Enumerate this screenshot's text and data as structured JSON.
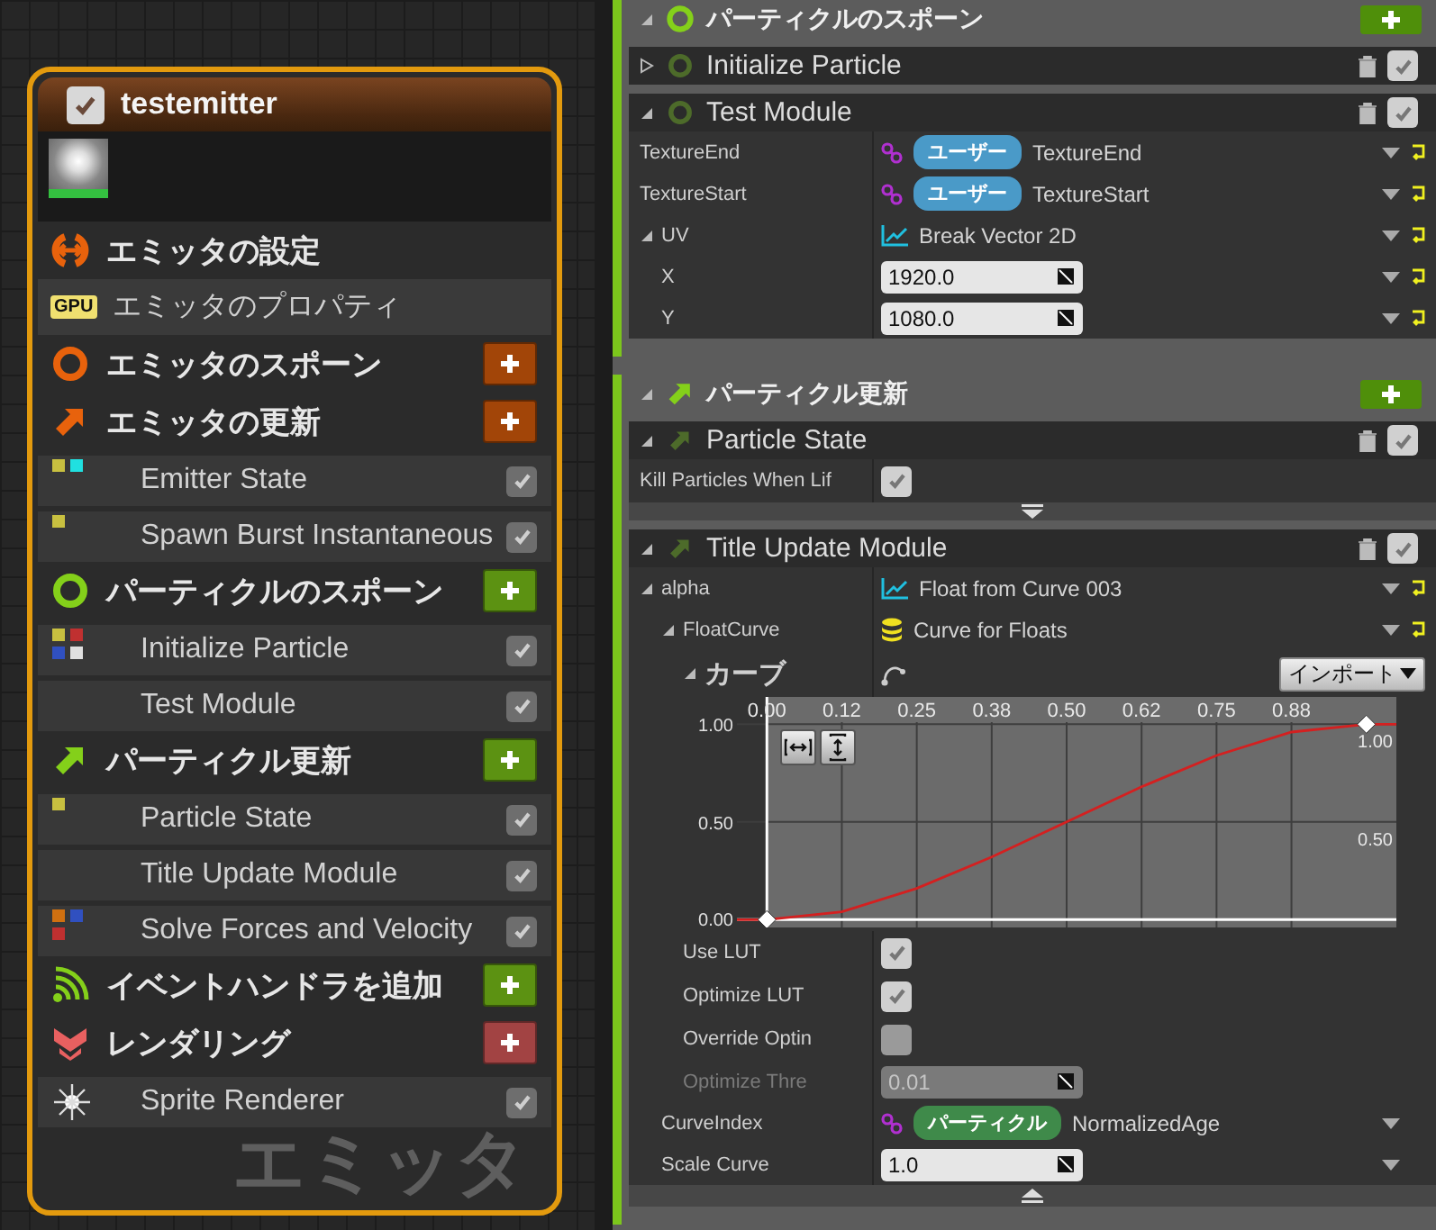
{
  "emitter_node": {
    "title": "testemitter",
    "enabled": true,
    "watermark": "エミッタ",
    "items": [
      {
        "kind": "settings",
        "label": "エミッタの設定",
        "color": "#e8620c"
      },
      {
        "kind": "properties",
        "badge": "GPU",
        "label": "エミッタのプロパティ"
      },
      {
        "kind": "spawn",
        "label": "エミッタのスポーン",
        "color": "#e8620c"
      },
      {
        "kind": "update",
        "label": "エミッタの更新",
        "color": "#e8620c"
      },
      {
        "kind": "module",
        "label": "Emitter State",
        "checked": true,
        "dots": [
          {
            "color": "#c8c040"
          },
          {
            "color": "#20e0e0"
          }
        ]
      },
      {
        "kind": "module",
        "label": "Spawn Burst Instantaneous",
        "checked": true,
        "dots": [
          {
            "color": "#c8c040"
          }
        ]
      },
      {
        "kind": "spawn",
        "label": "パーティクルのスポーン",
        "color": "#84d01a"
      },
      {
        "kind": "module",
        "label": "Initialize Particle",
        "checked": true,
        "dots": [
          {
            "color": "#c8c040"
          },
          {
            "color": "#c03030"
          },
          {
            "color": "#3050c0"
          },
          {
            "color": "#e0e0e0"
          }
        ]
      },
      {
        "kind": "module",
        "label": "Test Module",
        "checked": true
      },
      {
        "kind": "update",
        "label": "パーティクル更新",
        "color": "#84d01a"
      },
      {
        "kind": "module",
        "label": "Particle State",
        "checked": true,
        "dots": [
          {
            "color": "#c8c040"
          }
        ]
      },
      {
        "kind": "module",
        "label": "Title Update Module",
        "checked": true
      },
      {
        "kind": "module",
        "label": "Solve Forces and Velocity",
        "checked": true,
        "dots": [
          {
            "color": "#d07010"
          },
          {
            "color": "#3050c0"
          },
          {
            "color": "#c03030"
          }
        ]
      },
      {
        "kind": "event",
        "label": "イベントハンドラを追加",
        "color": "#84d01a"
      },
      {
        "kind": "render",
        "label": "レンダリング",
        "color": "#e86060"
      },
      {
        "kind": "renderer",
        "label": "Sprite Renderer",
        "checked": true
      }
    ]
  },
  "stack": {
    "sections": [
      {
        "kind": "spawn",
        "title": "パーティクルのスポーン",
        "expanded": true,
        "modules": [
          {
            "title": "Initialize Particle",
            "expanded": false,
            "enabled": true
          },
          {
            "title": "Test Module",
            "expanded": true,
            "enabled": true,
            "rows": [
              {
                "kind": "link",
                "label": "TextureEnd",
                "tag": "ユーザー",
                "color": "#4a9ac8",
                "value": "TextureEnd",
                "reset": true
              },
              {
                "kind": "link",
                "label": "TextureStart",
                "tag": "ユーザー",
                "color": "#4a9ac8",
                "value": "TextureStart",
                "reset": true
              },
              {
                "kind": "function",
                "label": "UV",
                "value": "Break Vector 2D",
                "reset": true,
                "expanded": true,
                "children": [
                  {
                    "kind": "number",
                    "label": "X",
                    "value": "1920.0",
                    "reset": true
                  },
                  {
                    "kind": "number",
                    "label": "Y",
                    "value": "1080.0",
                    "reset": true
                  }
                ]
              }
            ]
          }
        ]
      },
      {
        "kind": "update",
        "title": "パーティクル更新",
        "expanded": true,
        "modules": [
          {
            "title": "Particle State",
            "expanded": true,
            "enabled": true,
            "advanced_shown": false,
            "rows": [
              {
                "kind": "check",
                "label": "Kill Particles When Lif",
                "checked": true
              }
            ]
          },
          {
            "title": "Title Update Module",
            "expanded": true,
            "enabled": true,
            "advanced_shown": true,
            "rows": [
              {
                "kind": "function",
                "label": "alpha",
                "value": "Float from Curve 003",
                "reset": true,
                "expanded": true,
                "children": [
                  {
                    "kind": "asset",
                    "label": "FloatCurve",
                    "value": "Curve for Floats",
                    "reset": true,
                    "expanded": true,
                    "children": [
                      {
                        "kind": "curve",
                        "label": "カーブ",
                        "expanded": true,
                        "button": "インポート",
                        "chart_data": {
                          "type": "line",
                          "xlim": [
                            -0.05,
                            1.05
                          ],
                          "ylim": [
                            -0.04,
                            1.14
                          ],
                          "grid": true,
                          "x": [
                            -0.05,
                            0,
                            0.125,
                            0.25,
                            0.375,
                            0.5,
                            0.625,
                            0.75,
                            0.875,
                            1,
                            1.05
                          ],
                          "series": [
                            {
                              "color": "#d42020",
                              "values": [
                                0,
                                0,
                                0.04,
                                0.16,
                                0.32,
                                0.5,
                                0.68,
                                0.84,
                                0.96,
                                1,
                                1
                              ]
                            }
                          ],
                          "xticks": [
                            {
                              "value": 0,
                              "label": "0.00"
                            },
                            {
                              "value": 0.125,
                              "label": "0.12"
                            },
                            {
                              "value": 0.25,
                              "label": "0.25"
                            },
                            {
                              "value": 0.375,
                              "label": "0.38"
                            },
                            {
                              "value": 0.5,
                              "label": "0.50"
                            },
                            {
                              "value": 0.625,
                              "label": "0.62"
                            },
                            {
                              "value": 0.75,
                              "label": "0.75"
                            },
                            {
                              "value": 0.875,
                              "label": "0.88"
                            }
                          ],
                          "yticks": [
                            {
                              "value": 0,
                              "label": "0.00"
                            },
                            {
                              "value": 0.5,
                              "label": "0.50"
                            },
                            {
                              "value": 1,
                              "label": "1.00"
                            }
                          ]
                        }
                      },
                      {
                        "kind": "check",
                        "label": "Use LUT",
                        "checked": true
                      },
                      {
                        "kind": "check",
                        "label": "Optimize LUT",
                        "checked": true
                      },
                      {
                        "kind": "check",
                        "label": "Override Optin",
                        "checked": false
                      },
                      {
                        "kind": "number",
                        "label": "Optimize Thre",
                        "value": "0.01",
                        "disabled": true
                      }
                    ]
                  },
                  {
                    "kind": "link",
                    "label": "CurveIndex",
                    "tag": "パーティクル",
                    "color": "#3f8a4a",
                    "value": "NormalizedAge",
                    "reset": false
                  },
                  {
                    "kind": "number",
                    "label": "Scale Curve",
                    "value": "1.0",
                    "reset": false
                  }
                ]
              }
            ]
          }
        ]
      }
    ]
  }
}
